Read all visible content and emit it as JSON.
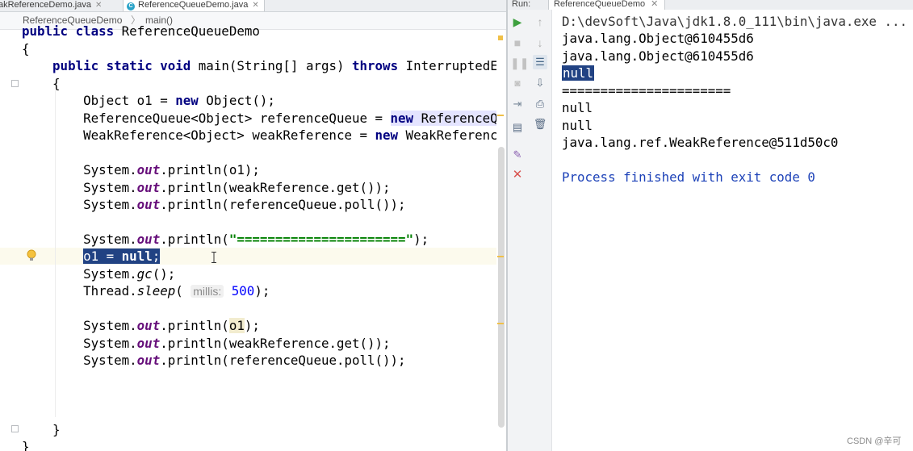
{
  "editor": {
    "tabs": [
      {
        "label": "akReferenceDemo.java",
        "active": false
      },
      {
        "label": "ReferenceQueueDemo.java",
        "active": true
      }
    ],
    "tab_icon_letter": "C",
    "breadcrumb": [
      "ReferenceQueueDemo",
      "main()"
    ],
    "code": {
      "l0_kw1": "public",
      "l0_kw2": "class",
      "l0_name": "ReferenceQueueDemo",
      "l1": "{",
      "l2_kw1": "public",
      "l2_kw2": "static",
      "l2_kw3": "void",
      "l2_a": " main(String[] args) ",
      "l2_kw4": "throws",
      "l2_b": " InterruptedE",
      "l3": "{",
      "l4_a": "Object ",
      "l4_var": "o1",
      "l4_b": " = ",
      "l4_kw": "new",
      "l4_c": " Object();",
      "l5_a": "ReferenceQueue<Object> referenceQueue = ",
      "l5_kw": "new",
      "l5_b": " ReferenceQ",
      "l6_a": "WeakReference<Object> weakReference = ",
      "l6_kw": "new",
      "l6_b": " WeakReferenc",
      "print_a": "System.",
      "print_field": "out",
      "print_m": ".println(",
      "l8_arg": "o1",
      "l8_end": ");",
      "l9_arg": "weakReference.get());",
      "l10_arg": "referenceQueue.poll());",
      "l12_str": "\"======================\"",
      "l12_end": ");",
      "l13_var": "o1",
      "l13_eq": " = ",
      "l13_kw": "null",
      "l13_semi": ";",
      "l14_a": "System.",
      "l14_m": "gc",
      "l14_b": "();",
      "l15_a": "Thread.",
      "l15_m": "sleep",
      "l15_b": "( ",
      "l15_hint": "millis:",
      "l15_num": "500",
      "l15_c": ");",
      "l17_arg": "o1",
      "l17_end": ");",
      "l18_arg": "weakReference.get());",
      "l19_arg": "referenceQueue.poll());",
      "l21": "}",
      "l22": "}"
    }
  },
  "run": {
    "label": "Run:",
    "tab": "ReferenceQueueDemo",
    "console": [
      "D:\\devSoft\\Java\\jdk1.8.0_111\\bin\\java.exe ...",
      "java.lang.Object@610455d6",
      "java.lang.Object@610455d6",
      "null",
      "======================",
      "null",
      "null",
      "java.lang.ref.WeakReference@511d50c0",
      "",
      "Process finished with exit code 0"
    ]
  },
  "watermark": "CSDN @辛可"
}
